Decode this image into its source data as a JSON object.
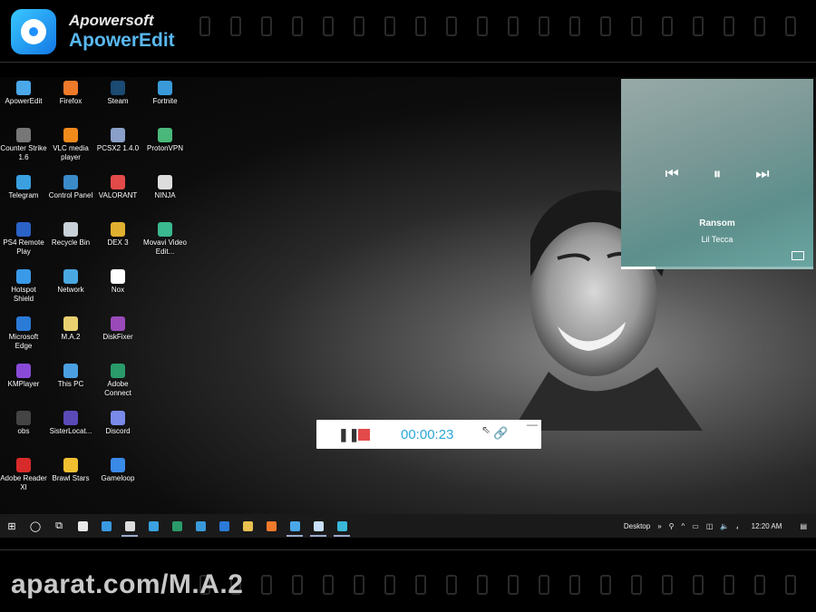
{
  "brand": {
    "company": "Apowersoft",
    "product": "ApowerEdit"
  },
  "desktop_icons": [
    [
      {
        "label": "ApowerEdit",
        "color": "#4aa8e8"
      },
      {
        "label": "Firefox",
        "color": "#f07a2a"
      },
      {
        "label": "Steam",
        "color": "#1b4a72"
      },
      {
        "label": "Fortnite",
        "color": "#3a9ad9"
      }
    ],
    [
      {
        "label": "Counter Strike 1.6",
        "color": "#777777"
      },
      {
        "label": "VLC media player",
        "color": "#f08a1a"
      },
      {
        "label": "PCSX2 1.4.0",
        "color": "#8aa0c8"
      },
      {
        "label": "ProtonVPN",
        "color": "#4ab87a"
      }
    ],
    [
      {
        "label": "Telegram",
        "color": "#3aa0e0"
      },
      {
        "label": "Control Panel",
        "color": "#3a8ac8"
      },
      {
        "label": "VALORANT",
        "color": "#e24a4a"
      },
      {
        "label": "NINJA",
        "color": "#dddddd"
      }
    ],
    [
      {
        "label": "PS4 Remote Play",
        "color": "#2a62c8"
      },
      {
        "label": "Recycle Bin",
        "color": "#c8d0d8"
      },
      {
        "label": "DEX 3",
        "color": "#e0b030"
      },
      {
        "label": "Movavi Video Edit...",
        "color": "#3ab890"
      }
    ],
    [
      {
        "label": "Hotspot Shield",
        "color": "#3a9ae8"
      },
      {
        "label": "Network",
        "color": "#4aa8e0"
      },
      {
        "label": "Nox",
        "color": "#ffffff"
      }
    ],
    [
      {
        "label": "Microsoft Edge",
        "color": "#2a7ad8"
      },
      {
        "label": "M.A.2",
        "color": "#e8d070"
      },
      {
        "label": "DiskFixer",
        "color": "#9a4ab8"
      }
    ],
    [
      {
        "label": "KMPlayer",
        "color": "#8a4ad8"
      },
      {
        "label": "This PC",
        "color": "#4aa0e0"
      },
      {
        "label": "Adobe Connect",
        "color": "#2a9a6a"
      }
    ],
    [
      {
        "label": "obs",
        "color": "#444444"
      },
      {
        "label": "SisterLocat...",
        "color": "#5a4ab8"
      },
      {
        "label": "Discord",
        "color": "#7a8ae8"
      }
    ],
    [
      {
        "label": "Adobe Reader XI",
        "color": "#d82a2a"
      },
      {
        "label": "Brawl Stars",
        "color": "#f0c030"
      },
      {
        "label": "Gameloop",
        "color": "#3a8ae8"
      }
    ]
  ],
  "media_player": {
    "song_title": "Ransom",
    "artist": "Lil Tecca",
    "progress": 0.18,
    "icons": {
      "prev": "⏮",
      "play_pause": "⏸",
      "next": "⏭"
    }
  },
  "recorder": {
    "elapsed_time": "00:00:23",
    "pause_glyph": "❚❚",
    "link_glyph": "🔗",
    "min_glyph": "—",
    "cursor_glyph": "⇖"
  },
  "taskbar": {
    "items": [
      {
        "name": "start-icon",
        "glyph": "⊞",
        "color": "#ffffff"
      },
      {
        "name": "search-circle-icon",
        "glyph": "◯",
        "color": "#ffffff"
      },
      {
        "name": "task-view-icon",
        "glyph": "⧉",
        "color": "#ffffff"
      },
      {
        "name": "store-icon",
        "glyph": "",
        "color": "#e8e8e8"
      },
      {
        "name": "mail-icon",
        "glyph": "",
        "color": "#3a9ae0"
      },
      {
        "name": "obs-icon",
        "glyph": "",
        "color": "#dddddd"
      },
      {
        "name": "telegram-icon",
        "glyph": "",
        "color": "#3aa0e0"
      },
      {
        "name": "app-icon",
        "glyph": "",
        "color": "#2a9a6a"
      },
      {
        "name": "fortnite-icon",
        "glyph": "",
        "color": "#3a9ad9"
      },
      {
        "name": "edge-icon",
        "glyph": "",
        "color": "#2a7ad8"
      },
      {
        "name": "explorer-icon",
        "glyph": "",
        "color": "#e8c050"
      },
      {
        "name": "firefox-icon",
        "glyph": "",
        "color": "#f07a2a"
      },
      {
        "name": "apoweredit-icon",
        "glyph": "",
        "color": "#4aa8e8"
      },
      {
        "name": "cloud-icon",
        "glyph": "",
        "color": "#c8e0f8"
      },
      {
        "name": "recorder-icon",
        "glyph": "",
        "color": "#3ab8d8"
      }
    ],
    "tray_label": "Desktop",
    "tray_chevron": "»",
    "tray_up": "^",
    "tray_lang": "ﺑ",
    "clock": "12:20 AM"
  },
  "watermark": "aparat.com/M.A.2"
}
